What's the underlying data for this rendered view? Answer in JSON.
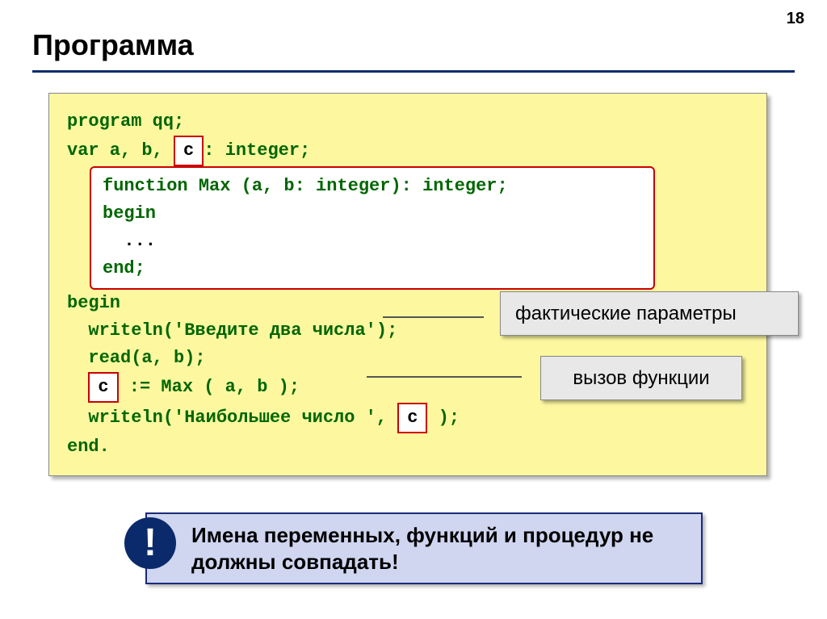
{
  "page_number": "18",
  "title": "Программа",
  "code": {
    "line1": "program qq;",
    "line2_prefix": "var a, b, ",
    "line2_c": "c",
    "line2_suffix": ": integer;",
    "func_line1": "function Max (a, b: integer): integer;",
    "func_line2": "begin",
    "func_line3": "  ...",
    "func_line4": "end;",
    "line3": "begin",
    "line4": "  writeln('Введите два числа');",
    "line5": "  read(a, b);",
    "line6_prefix": "  ",
    "line6_c": "c",
    "line6_suffix": " := Max ( a, b );",
    "line7_prefix": "  writeln('Наибольшее число ', ",
    "line7_c": "c",
    "line7_suffix": " );",
    "line8": "end."
  },
  "callouts": {
    "actual_params": "фактические параметры",
    "function_call": "вызов функции"
  },
  "note": {
    "icon": "!",
    "text": "Имена переменных, функций и процедур не должны совпадать!"
  }
}
